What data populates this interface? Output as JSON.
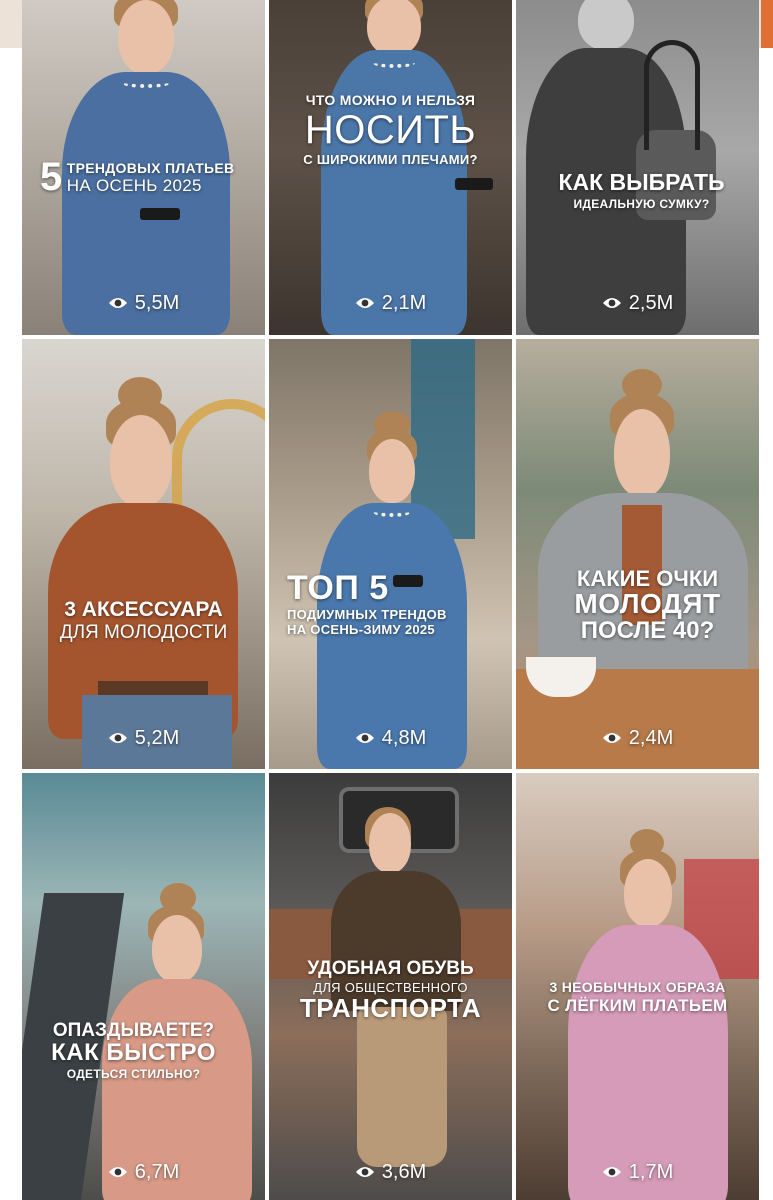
{
  "colors": {
    "top_bar": "#ede2d8",
    "accent": "#e06f33",
    "text": "#ffffff"
  },
  "videos": [
    {
      "caption_lines": [
        "5",
        "ТРЕНДОВЫХ ПЛАТЬЕВ",
        "НА ОСЕНЬ 2025"
      ],
      "views": "5,5M",
      "icon": "eye-icon"
    },
    {
      "caption_lines": [
        "ЧТО МОЖНО И НЕЛЬЗЯ",
        "НОСИТЬ",
        "С ШИРОКИМИ ПЛЕЧАМИ?"
      ],
      "views": "2,1M",
      "icon": "eye-icon"
    },
    {
      "caption_lines": [
        "КАК ВЫБРАТЬ",
        "ИДЕАЛЬНУЮ СУМКУ?"
      ],
      "views": "2,5M",
      "icon": "eye-icon"
    },
    {
      "caption_lines": [
        "3 АКСЕССУАРА",
        "ДЛЯ МОЛОДОСТИ"
      ],
      "views": "5,2M",
      "icon": "eye-icon"
    },
    {
      "caption_lines": [
        "ТОП 5",
        "ПОДИУМНЫХ ТРЕНДОВ",
        "НА ОСЕНЬ-ЗИМУ 2025"
      ],
      "views": "4,8M",
      "icon": "eye-icon"
    },
    {
      "caption_lines": [
        "КАКИЕ ОЧКИ",
        "МОЛОДЯТ",
        "ПОСЛЕ 40?"
      ],
      "views": "2,4M",
      "icon": "eye-icon"
    },
    {
      "caption_lines": [
        "ОПАЗДЫВАЕТЕ?",
        "КАК БЫСТРО",
        "ОДЕТЬСЯ СТИЛЬНО?"
      ],
      "views": "6,7M",
      "icon": "eye-icon"
    },
    {
      "caption_lines": [
        "УДОБНАЯ ОБУВЬ",
        "ДЛЯ ОБЩЕСТВЕННОГО",
        "ТРАНСПОРТА"
      ],
      "views": "3,6M",
      "icon": "eye-icon"
    },
    {
      "caption_lines": [
        "3 НЕОБЫЧНЫХ ОБРАЗА",
        "С ЛЁГКИМ ПЛАТЬЕМ"
      ],
      "views": "1,7M",
      "icon": "eye-icon"
    }
  ]
}
